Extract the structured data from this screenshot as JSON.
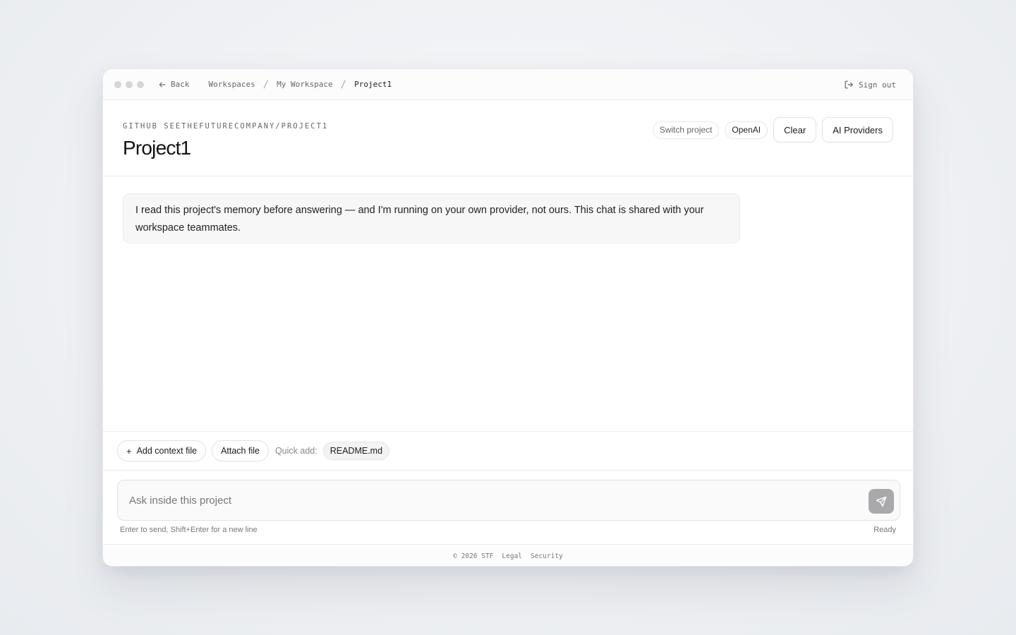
{
  "titlebar": {
    "back_label": "Back",
    "breadcrumbs": [
      "Workspaces",
      "My Workspace",
      "Project1"
    ],
    "signout_label": "Sign out"
  },
  "header": {
    "repo_label": "GITHUB SEETHEFUTURECOMPANY/PROJECT1",
    "title": "Project1",
    "switch_project_label": "Switch project",
    "provider_label": "OpenAI",
    "clear_label": "Clear",
    "ai_providers_label": "AI Providers"
  },
  "messages": [
    {
      "role": "assistant",
      "text": "I read this project's memory before answering — and I'm running on your own provider, not ours. This chat is shared with your workspace teammates."
    }
  ],
  "context": {
    "add_context_label": "Add context file",
    "attach_label": "Attach file",
    "quick_add_label": "Quick add:",
    "quick_add_items": [
      "README.md"
    ]
  },
  "composer": {
    "placeholder": "Ask inside this project",
    "value": "",
    "hint": "Enter to send, Shift+Enter for a new line",
    "status": "Ready"
  },
  "footer": {
    "copyright": "© 2026 STF",
    "legal_label": "Legal",
    "security_label": "Security"
  }
}
